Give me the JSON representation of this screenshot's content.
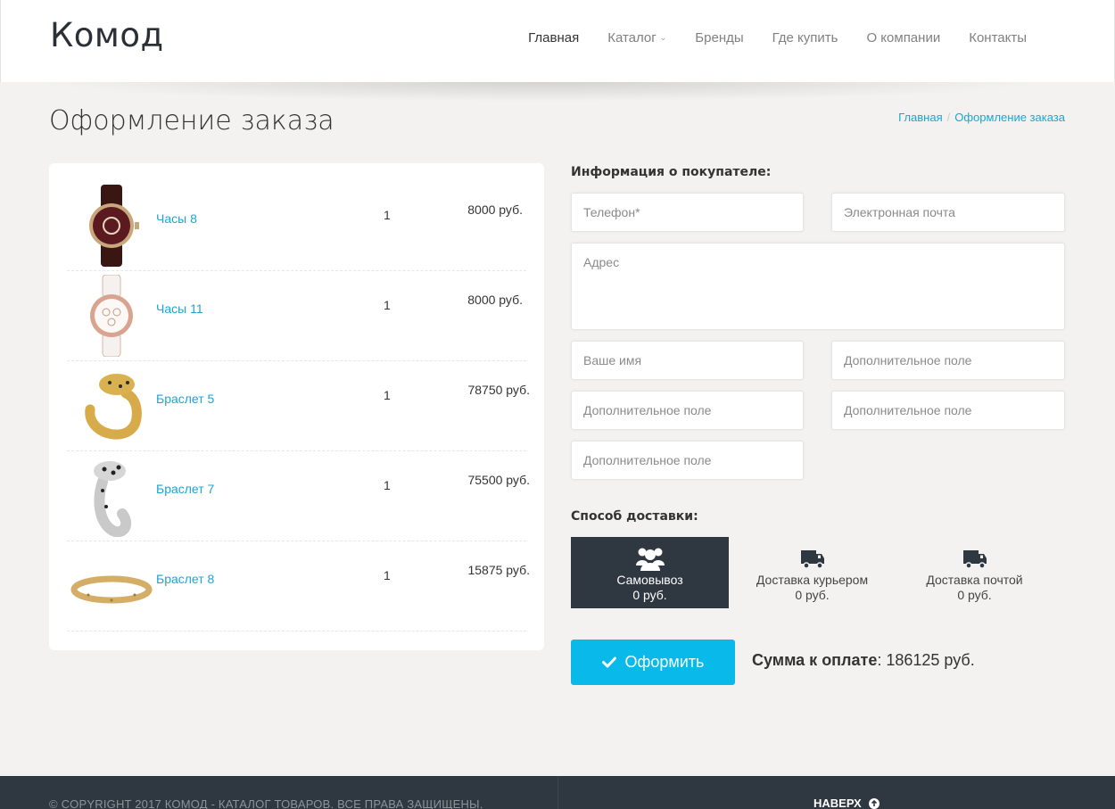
{
  "header": {
    "logo": "Комод",
    "nav": [
      {
        "label": "Главная"
      },
      {
        "label": "Каталог"
      },
      {
        "label": "Бренды"
      },
      {
        "label": "Где купить"
      },
      {
        "label": "О компании"
      },
      {
        "label": "Контакты"
      }
    ]
  },
  "page": {
    "title": "Оформление заказа",
    "breadcrumb": [
      "Главная",
      "/",
      "Оформление заказа"
    ]
  },
  "cart": {
    "items": [
      {
        "name": "Часы 8",
        "qty": "1",
        "price": "8000 руб.",
        "image": "watch-dark"
      },
      {
        "name": "Часы 11",
        "qty": "1",
        "price": "8000 руб.",
        "image": "watch-rose"
      },
      {
        "name": "Браслет 5",
        "qty": "1",
        "price": "78750 руб.",
        "image": "bracelet-panther-gold"
      },
      {
        "name": "Браслет 7",
        "qty": "1",
        "price": "75500 руб.",
        "image": "bracelet-panther-silver"
      },
      {
        "name": "Браслет 8",
        "qty": "1",
        "price": "15875 руб.",
        "image": "bracelet-bangle-gold"
      }
    ]
  },
  "buyer": {
    "heading": "Информация о покупателе:",
    "fields": {
      "phone": "Телефон*",
      "email": "Электронная почта",
      "address": "Адрес",
      "name": "Ваше имя",
      "extra": "Дополнительное поле"
    }
  },
  "delivery": {
    "heading": "Способ доставки:",
    "options": [
      {
        "name": "Самовывоз",
        "price": "0 руб.",
        "icon": "users-icon",
        "selected": true
      },
      {
        "name": "Доставка курьером",
        "price": "0 руб.",
        "icon": "truck-icon",
        "selected": false
      },
      {
        "name": "Доставка почтой",
        "price": "0 руб.",
        "icon": "truck-icon",
        "selected": false
      }
    ]
  },
  "checkout": {
    "button": "Оформить",
    "total_label": "Сумма к оплате",
    "total_value": ": 186125 руб."
  },
  "footer": {
    "copyright": "© COPYRIGHT 2017 КОМОД - КАТАЛОГ ТОВАРОВ. ВСЕ ПРАВА ЗАЩИЩЕНЫ.",
    "to_top": "НАВЕРХ"
  },
  "colors": {
    "accent": "#08b9e9",
    "link": "#1ba5d6",
    "dark": "#2f3740",
    "background": "#f3f2f0"
  }
}
